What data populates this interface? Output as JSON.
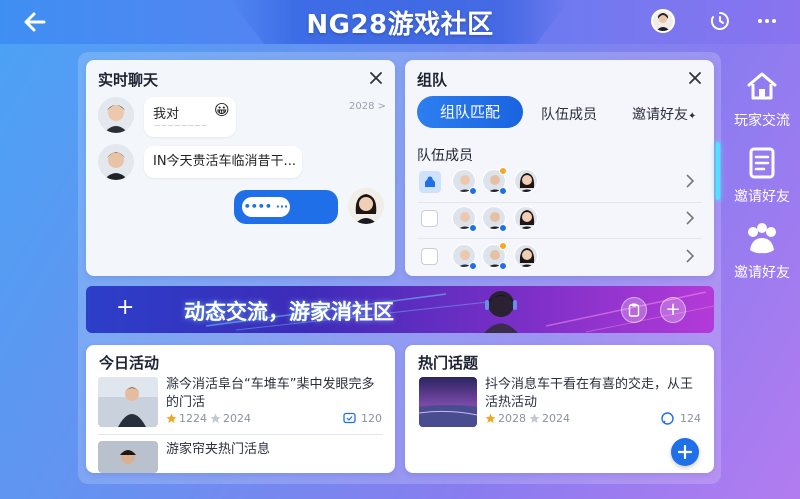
{
  "header": {
    "title": "NG28游戏社区",
    "back_icon": "back-arrow-icon",
    "history_icon": "history-clock-icon",
    "more_icon": "more-dots-icon"
  },
  "chat": {
    "title": "实时聊天",
    "messages": [
      {
        "text": "我对",
        "emoji": "😀",
        "sub": "~~~~~~~~",
        "time": "2028 >"
      },
      {
        "text": "IN今天贵活车临消昔干..."
      },
      {
        "text": "•••• ···"
      }
    ],
    "input_placeholder": ""
  },
  "team": {
    "title": "组队",
    "tabs": [
      "组队匹配",
      "队伍成员",
      "邀请好友"
    ],
    "tab_suffix": "✦",
    "section_title": "队伍成员"
  },
  "banner": {
    "text": "动态交流，游家消社区",
    "plus_left": "+",
    "plus_right": "+"
  },
  "today": {
    "title": "今日活动",
    "items": [
      {
        "text": "滁今消活阜台“车堆车”棐中发眼完多的门活",
        "likes": "1224",
        "stars": "2024",
        "comments": "120"
      },
      {
        "text": "游家帘夹热门活息",
        "likes": "",
        "stars": "",
        "comments": ""
      }
    ]
  },
  "hot": {
    "title": "热门话题",
    "items": [
      {
        "text": "抖今消息车干看在有喜的交走，从王活热活动",
        "likes": "2028",
        "stars": "2024",
        "comments": "124"
      }
    ],
    "fab": "+"
  },
  "sidebar": {
    "items": [
      {
        "label": "玩家交流",
        "icon": "home-icon"
      },
      {
        "label": "邀请好友",
        "icon": "document-list-icon"
      },
      {
        "label": "邀请好友",
        "icon": "paw-group-icon"
      }
    ]
  },
  "colors": {
    "accent": "#1e6fe8",
    "star": "#f5a623",
    "glow": "#4fe3ff"
  }
}
